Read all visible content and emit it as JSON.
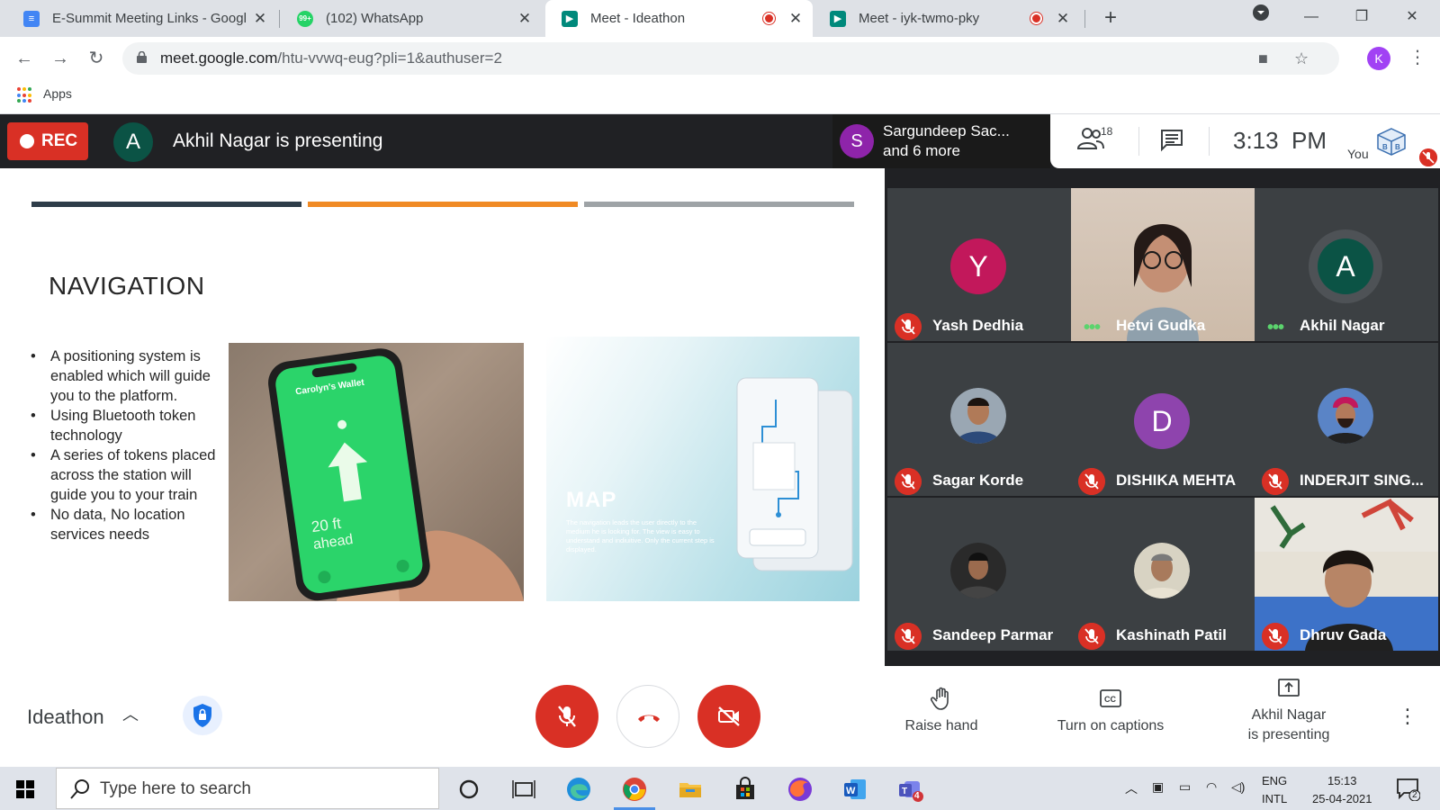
{
  "browser": {
    "tabs": [
      {
        "title": "E-Summit Meeting Links - Googl",
        "icon": "google-docs-icon",
        "recording": false
      },
      {
        "title": "(102) WhatsApp",
        "icon": "whatsapp-icon",
        "recording": false
      },
      {
        "title": "Meet - Ideathon",
        "icon": "google-meet-icon",
        "recording": true,
        "active": true
      },
      {
        "title": "Meet - iyk-twmo-pky",
        "icon": "google-meet-icon",
        "recording": true
      }
    ],
    "url_host": "meet.google.com",
    "url_path": "/htu-vvwq-eug?pli=1&authuser=2",
    "profile_initial": "K",
    "bookmarks_apps_label": "Apps",
    "whatsapp_badge": "99+"
  },
  "meet_top": {
    "rec_label": "REC",
    "presenter_initial": "A",
    "presenting_text": "Akhil Nagar is presenting",
    "speaker_initial": "S",
    "speaker_line1": "Sargundeep Sac...",
    "speaker_line2": "and 6 more",
    "people_count": "18",
    "time": "3:13  PM",
    "you_label": "You"
  },
  "slide": {
    "title": "NAVIGATION",
    "bullets": [
      "A positioning system is enabled which will guide you to the platform.",
      "Using Bluetooth token technology",
      "A series of tokens placed across the station will guide you to your train",
      "No data, No location services needs"
    ],
    "phone_wallet_label": "Carolyn's Wallet",
    "phone_distance": "20 ft",
    "phone_distance_sub": "ahead",
    "map_title": "MAP",
    "map_description": "The navigation leads the user directly to the medium he is looking for. The view is easy to understand and indiuitive. Only the current step is displayed.",
    "bar_colors": [
      "#2e3d49",
      "#f08a24",
      "#9ea3a6"
    ]
  },
  "participants": [
    {
      "name": "Yash Dedhia",
      "initial": "Y",
      "color": "#c2185b",
      "muted": true,
      "type": "avatar"
    },
    {
      "name": "Hetvi Gudka",
      "initial": "",
      "color": "",
      "muted": false,
      "type": "video"
    },
    {
      "name": "Akhil Nagar",
      "initial": "A",
      "color": "#0b5345",
      "muted": false,
      "type": "avatar-ring"
    },
    {
      "name": "Sagar Korde",
      "initial": "",
      "color": "",
      "muted": true,
      "type": "photo"
    },
    {
      "name": "DISHIKA MEHTA",
      "initial": "D",
      "color": "#8e44ad",
      "muted": true,
      "type": "avatar"
    },
    {
      "name": "INDERJIT SING...",
      "initial": "",
      "color": "",
      "muted": true,
      "type": "photo"
    },
    {
      "name": "Sandeep Parmar",
      "initial": "",
      "color": "",
      "muted": true,
      "type": "photo"
    },
    {
      "name": "Kashinath Patil",
      "initial": "",
      "color": "",
      "muted": true,
      "type": "photo"
    },
    {
      "name": "Dhruv Gada",
      "initial": "",
      "color": "",
      "muted": true,
      "type": "video"
    }
  ],
  "controls": {
    "meeting_name": "Ideathon",
    "raise_hand": "Raise hand",
    "captions": "Turn on captions",
    "presenting_line1": "Akhil Nagar",
    "presenting_line2": "is presenting"
  },
  "taskbar": {
    "search_placeholder": "Type here to search",
    "lang_line1": "ENG",
    "lang_line2": "INTL",
    "time": "15:13",
    "date": "25-04-2021",
    "teams_badge": "4",
    "notif_count": "2"
  }
}
